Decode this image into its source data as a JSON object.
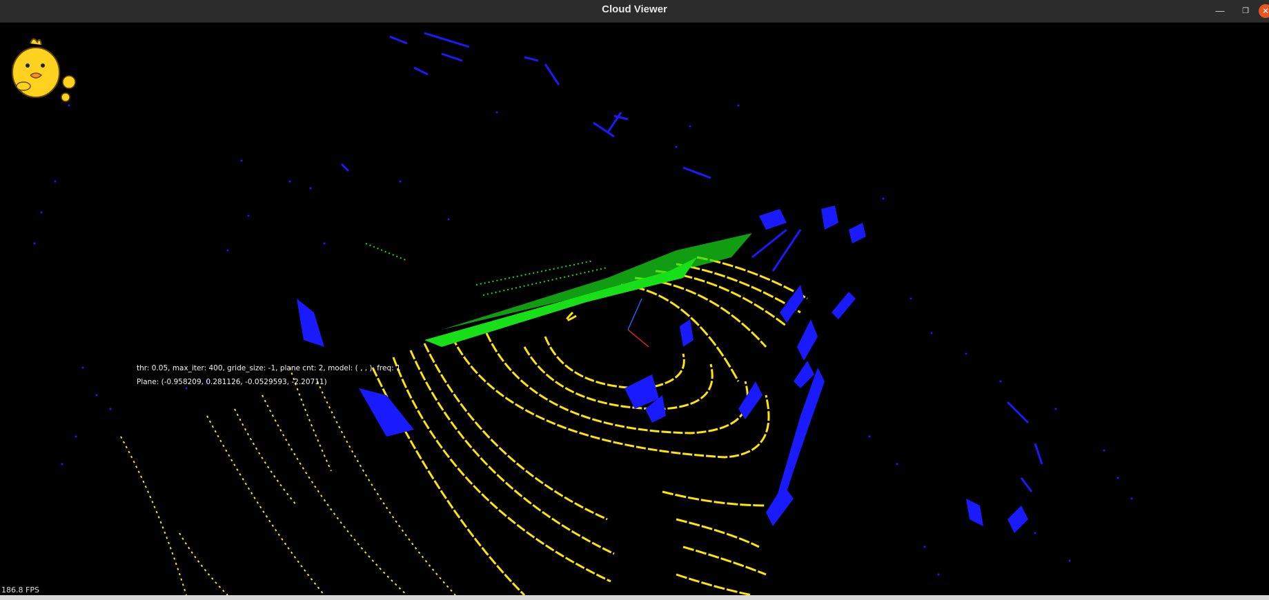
{
  "window": {
    "title": "Cloud Viewer",
    "minimize_icon": "minimize-icon",
    "maximize_icon": "restore-icon",
    "close_icon": "close-icon"
  },
  "overlay": {
    "params_text": "thr: 0.05, max_iter: 400, gride_size: -1, plane cnt: 2, model: ( , , ), freq: 1",
    "plane_text": "Plane: (-0.958209, 0.281126, -0.0529593, -2.20711)",
    "fps_text": "186.8 FPS"
  },
  "colors": {
    "ground_points": "#ffe600",
    "plane_points": "#18e018",
    "obstacle_points": "#1a1aff",
    "background": "#000000",
    "titlebar": "#2c2c2c",
    "close_button": "#e95420"
  },
  "sticker": "yellow-chick-sticker"
}
